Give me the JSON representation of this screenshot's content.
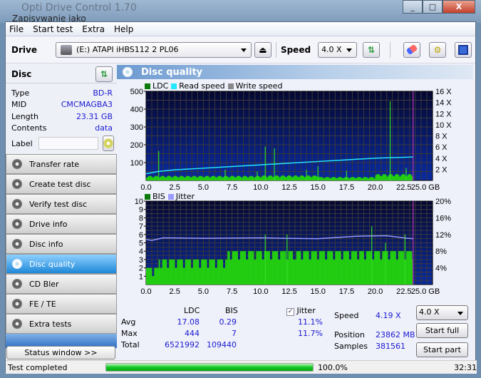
{
  "window": {
    "title": "Opti Drive Control 1.70",
    "subtitle": "Zapisywanie jako",
    "minimize": "_",
    "maximize": "□",
    "close": "X"
  },
  "menu": [
    "File",
    "Start test",
    "Extra",
    "Help"
  ],
  "toolbar": {
    "drive_label": "Drive",
    "drive_value": "(E:)   ATAPI iHBS112   2 PL06",
    "speed_label": "Speed",
    "speed_value": "4.0 X"
  },
  "disc": {
    "header": "Disc",
    "rows": [
      {
        "k": "Type",
        "v": "BD-R"
      },
      {
        "k": "MID",
        "v": "CMCMAGBA3"
      },
      {
        "k": "Length",
        "v": "23.31 GB"
      },
      {
        "k": "Contents",
        "v": "data"
      }
    ],
    "label_label": "Label",
    "label_value": ""
  },
  "nav": [
    {
      "label": "Transfer rate"
    },
    {
      "label": "Create test disc"
    },
    {
      "label": "Verify test disc"
    },
    {
      "label": "Drive info"
    },
    {
      "label": "Disc info"
    },
    {
      "label": "Disc quality",
      "active": true
    },
    {
      "label": "CD Bler"
    },
    {
      "label": "FE / TE"
    },
    {
      "label": "Extra tests"
    }
  ],
  "status_window": "Status window >>",
  "statusbar": {
    "text": "Test completed",
    "progress": 100.0,
    "percent": "100.0%",
    "time": "32:31"
  },
  "panel_title": "Disc quality",
  "chart_data": [
    {
      "type": "bar",
      "title": "LDC",
      "legend": [
        "LDC",
        "Read speed",
        "Write speed"
      ],
      "legend_colors": [
        "#0a7a0a",
        "#22e8ff",
        "#888888"
      ],
      "x_ticks": [
        "0.0",
        "2.5",
        "5.0",
        "7.5",
        "10.0",
        "12.5",
        "15.0",
        "17.5",
        "20.0",
        "22.5",
        "25.0 GB"
      ],
      "xlim": [
        0,
        25
      ],
      "y_ticks": [
        "500",
        "400",
        "300",
        "200",
        "100"
      ],
      "ylim": [
        0,
        500
      ],
      "y2_ticks": [
        "16 X",
        "14 X",
        "12 X",
        "10 X",
        "8 X",
        "6 X",
        "4 X",
        "2 X"
      ],
      "y2lim": [
        0,
        16
      ],
      "end_marker_gb": 23.3,
      "ldc_baseline": [
        [
          0,
          20
        ],
        [
          5,
          20
        ],
        [
          10,
          22
        ],
        [
          15,
          15
        ],
        [
          20,
          28
        ],
        [
          23.3,
          20
        ]
      ],
      "ldc_spikes": [
        [
          1.1,
          165
        ],
        [
          6.9,
          60
        ],
        [
          9.7,
          50
        ],
        [
          10.4,
          190
        ],
        [
          11.2,
          180
        ],
        [
          14.0,
          60
        ],
        [
          15.0,
          80
        ],
        [
          17.5,
          55
        ],
        [
          21.3,
          444
        ],
        [
          22.7,
          70
        ]
      ],
      "read_speed": [
        [
          0,
          1.2
        ],
        [
          1,
          1.6
        ],
        [
          2.5,
          1.9
        ],
        [
          5,
          2.2
        ],
        [
          7.5,
          2.5
        ],
        [
          10,
          2.8
        ],
        [
          12.5,
          3.1
        ],
        [
          15,
          3.4
        ],
        [
          17.5,
          3.7
        ],
        [
          20,
          4.0
        ],
        [
          23.3,
          4.2
        ]
      ]
    },
    {
      "type": "bar",
      "title": "BIS",
      "legend": [
        "BIS",
        "Jitter"
      ],
      "legend_colors": [
        "#0a7a0a",
        "#9a9aff"
      ],
      "x_ticks": [
        "0.0",
        "2.5",
        "5.0",
        "7.5",
        "10.0",
        "12.5",
        "15.0",
        "17.5",
        "20.0",
        "22.5",
        "25.0 GB"
      ],
      "xlim": [
        0,
        25
      ],
      "y_ticks": [
        "10",
        "9",
        "8",
        "7",
        "6",
        "5",
        "4",
        "3",
        "2",
        "1"
      ],
      "ylim": [
        0,
        10
      ],
      "y2_ticks": [
        "20%",
        "16%",
        "12%",
        "8%",
        "4%"
      ],
      "y2lim": [
        0,
        20
      ],
      "bis_levels": [
        [
          0,
          2
        ],
        [
          1,
          3
        ],
        [
          4,
          3
        ],
        [
          7,
          4
        ],
        [
          23.3,
          4
        ]
      ],
      "bis_spikes": [
        [
          10.4,
          6
        ],
        [
          12.3,
          6
        ],
        [
          19.7,
          7
        ],
        [
          20.9,
          5
        ],
        [
          22.6,
          6
        ]
      ],
      "jitter": [
        [
          0,
          10.8
        ],
        [
          0.5,
          10.6
        ],
        [
          1.5,
          11.2
        ],
        [
          5,
          11.1
        ],
        [
          10,
          11.2
        ],
        [
          12,
          11.1
        ],
        [
          15,
          11.0
        ],
        [
          18.5,
          11.6
        ],
        [
          21,
          11.7
        ],
        [
          22.8,
          11.1
        ],
        [
          23.3,
          11.0
        ]
      ]
    }
  ],
  "stats": {
    "col_ldc": "LDC",
    "col_bis": "BIS",
    "jitter_label": "Jitter",
    "jitter_checked": true,
    "rows": [
      {
        "k": "Avg",
        "ldc": "17.08",
        "bis": "0.29",
        "jit": "11.1%"
      },
      {
        "k": "Max",
        "ldc": "444",
        "bis": "7",
        "jit": "11.7%"
      },
      {
        "k": "Total",
        "ldc": "6521992",
        "bis": "109440",
        "jit": ""
      }
    ],
    "speed_label": "Speed",
    "speed_value": "4.19 X",
    "position_label": "Position",
    "position_value": "23862 MB",
    "samples_label": "Samples",
    "samples_value": "381561",
    "speed_select": "4.0 X",
    "start_full": "Start full",
    "start_part": "Start part"
  }
}
